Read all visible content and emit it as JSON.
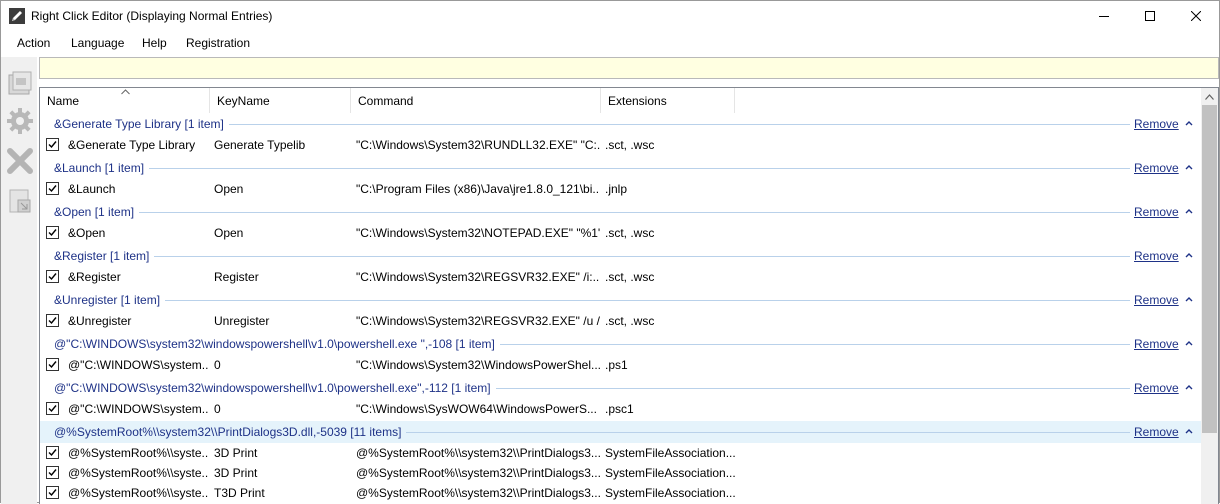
{
  "window": {
    "title": "Right Click Editor (Displaying Normal Entries)",
    "icon": "pencil-icon"
  },
  "menu": [
    "Action",
    "Language",
    "Help",
    "Registration"
  ],
  "toolbar": [
    "add-icon",
    "gear-icon",
    "delete-icon",
    "export-icon"
  ],
  "filter": {
    "value": ""
  },
  "columns": [
    "Name",
    "KeyName",
    "Command",
    "Extensions"
  ],
  "sort": {
    "column": "Name",
    "direction": "ascending"
  },
  "remove_label": "Remove",
  "groups": [
    {
      "label": "&Generate Type Library [1 item]",
      "highlighted": false,
      "rows": [
        {
          "checked": true,
          "name": "&Generate Type Library",
          "key": "Generate Typelib",
          "command": "\"C:\\Windows\\System32\\RUNDLL32.EXE\" \"C:...",
          "ext": ".sct, .wsc"
        }
      ]
    },
    {
      "label": "&Launch [1 item]",
      "highlighted": false,
      "rows": [
        {
          "checked": true,
          "name": "&Launch",
          "key": "Open",
          "command": "\"C:\\Program Files (x86)\\Java\\jre1.8.0_121\\bi...",
          "ext": ".jnlp"
        }
      ]
    },
    {
      "label": "&Open [1 item]",
      "highlighted": false,
      "rows": [
        {
          "checked": true,
          "name": "&Open",
          "key": "Open",
          "command": "\"C:\\Windows\\System32\\NOTEPAD.EXE\" \"%1\"",
          "ext": ".sct, .wsc"
        }
      ]
    },
    {
      "label": "&Register [1 item]",
      "highlighted": false,
      "rows": [
        {
          "checked": true,
          "name": "&Register",
          "key": "Register",
          "command": "\"C:\\Windows\\System32\\REGSVR32.EXE\" /i:...",
          "ext": ".sct, .wsc"
        }
      ]
    },
    {
      "label": "&Unregister [1 item]",
      "highlighted": false,
      "rows": [
        {
          "checked": true,
          "name": "&Unregister",
          "key": "Unregister",
          "command": "\"C:\\Windows\\System32\\REGSVR32.EXE\" /u /...",
          "ext": ".sct, .wsc"
        }
      ]
    },
    {
      "label": "@\"C:\\WINDOWS\\system32\\windowspowershell\\v1.0\\powershell.exe \",-108 [1 item]",
      "highlighted": false,
      "rows": [
        {
          "checked": true,
          "name": "@\"C:\\WINDOWS\\system...",
          "key": "0",
          "command": "\"C:\\Windows\\System32\\WindowsPowerShel...",
          "ext": ".ps1"
        }
      ]
    },
    {
      "label": "@\"C:\\WINDOWS\\system32\\windowspowershell\\v1.0\\powershell.exe\",-112 [1 item]",
      "highlighted": false,
      "rows": [
        {
          "checked": true,
          "name": "@\"C:\\WINDOWS\\system...",
          "key": "0",
          "command": "\"C:\\Windows\\SysWOW64\\WindowsPowerS...",
          "ext": ".psc1"
        }
      ]
    },
    {
      "label": "@%SystemRoot%\\\\system32\\\\PrintDialogs3D.dll,-5039 [11 items]",
      "highlighted": true,
      "rows": [
        {
          "checked": true,
          "name": "@%SystemRoot%\\\\syste...",
          "key": "3D Print",
          "command": "@%SystemRoot%\\\\system32\\\\PrintDialogs3...",
          "ext": "SystemFileAssociation..."
        },
        {
          "checked": true,
          "name": "@%SystemRoot%\\\\syste...",
          "key": "3D Print",
          "command": "@%SystemRoot%\\\\system32\\\\PrintDialogs3...",
          "ext": "SystemFileAssociation..."
        },
        {
          "checked": true,
          "name": "@%SystemRoot%\\\\syste...",
          "key": "T3D Print",
          "command": "@%SystemRoot%\\\\system32\\\\PrintDialogs3...",
          "ext": "SystemFileAssociation..."
        }
      ]
    }
  ]
}
